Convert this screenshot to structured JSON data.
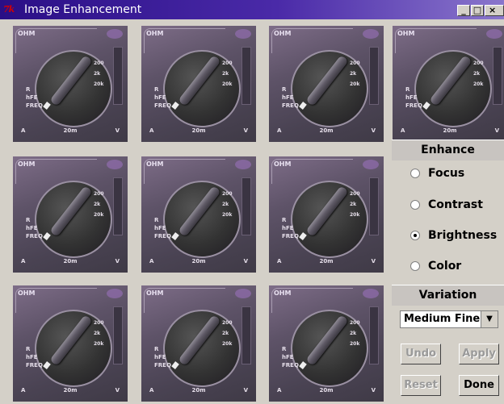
{
  "window": {
    "title": "Image Enhancement",
    "app_icon_text": "7k",
    "minimize_label": "_",
    "maximize_label": "□",
    "close_label": "×"
  },
  "thumbnail": {
    "mode_label": "OHM",
    "side_labels": [
      "R",
      "hFE",
      "FREQ"
    ],
    "bottom_labels": [
      "A",
      "20m",
      "V"
    ],
    "scale_labels": [
      "200",
      "2k",
      "20k"
    ],
    "count": 10
  },
  "enhance": {
    "header": "Enhance",
    "options": [
      {
        "label": "Focus",
        "checked": false
      },
      {
        "label": "Contrast",
        "checked": false
      },
      {
        "label": "Brightness",
        "checked": true
      },
      {
        "label": "Color",
        "checked": false
      }
    ]
  },
  "variation": {
    "header": "Variation",
    "selected": "Medium Fine",
    "arrow": "▼"
  },
  "buttons": {
    "undo": "Undo",
    "apply": "Apply",
    "reset": "Reset",
    "done": "Done"
  },
  "colors": {
    "titlebar_start": "#2a0f86",
    "panel_bg": "#d4d0c8",
    "disabled_text": "#9a9a9a"
  }
}
